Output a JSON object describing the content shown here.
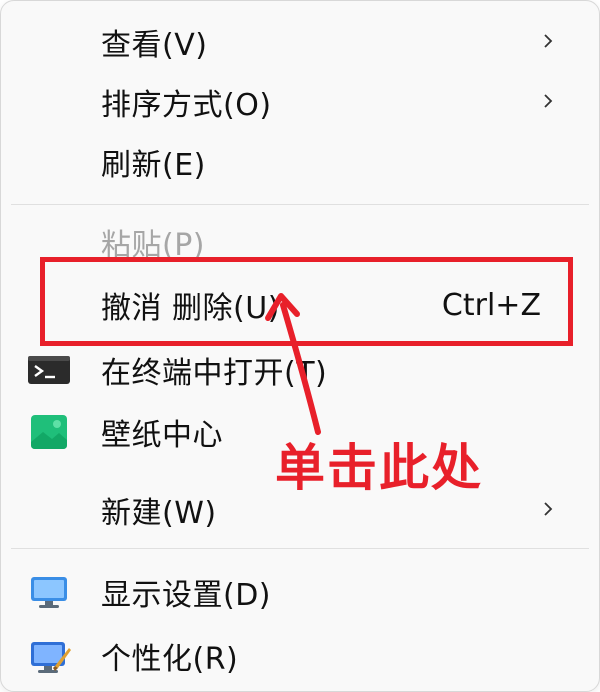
{
  "menu": {
    "items": [
      {
        "label": "查看(V)",
        "submenu": true
      },
      {
        "label": "排序方式(O)",
        "submenu": true
      },
      {
        "label": "刷新(E)"
      },
      {
        "label": "粘贴(P)",
        "disabled": true
      },
      {
        "label": "撤消 删除(U)",
        "shortcut": "Ctrl+Z"
      },
      {
        "label": "在终端中打开(T)",
        "icon": "terminal-icon"
      },
      {
        "label": "壁纸中心",
        "icon": "wallpaper-icon"
      },
      {
        "label": "新建(W)",
        "submenu": true
      },
      {
        "label": "显示设置(D)",
        "icon": "display-settings-icon"
      },
      {
        "label": "个性化(R)",
        "icon": "personalize-icon"
      }
    ]
  },
  "annotation": {
    "text": "单击此处",
    "color": "#e8202a"
  }
}
